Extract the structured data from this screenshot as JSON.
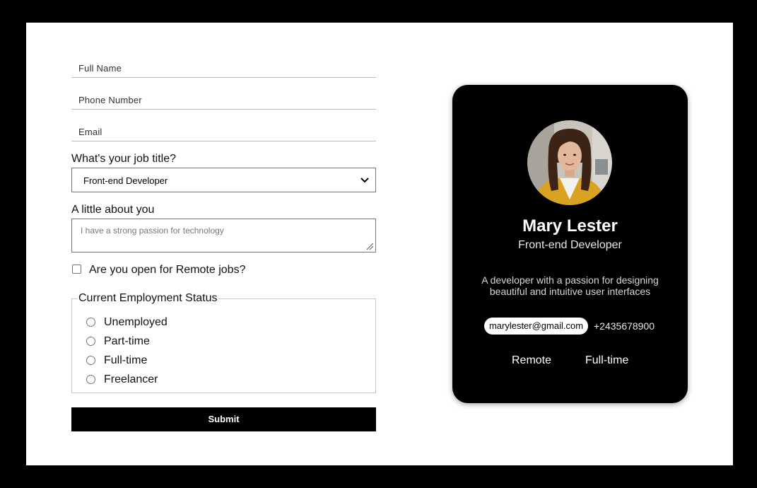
{
  "form": {
    "full_name_placeholder": "Full Name",
    "phone_placeholder": "Phone Number",
    "email_placeholder": "Email",
    "job_title_label": "What's your job title?",
    "job_title_value": "Front-end Developer",
    "about_label": "A little about you",
    "about_placeholder": "I have a strong passion for technology",
    "remote_label": "Are you open for Remote jobs?",
    "employment_legend": "Current Employment Status",
    "employment_options": [
      "Unemployed",
      "Part-time",
      "Full-time",
      "Freelancer"
    ],
    "submit_label": "Submit"
  },
  "card": {
    "name": "Mary Lester",
    "role": "Front-end Developer",
    "bio": "A developer with a passion for designing beautiful and intuitive user interfaces",
    "email": "marylester@gmail.com",
    "phone": "+2435678900",
    "tags": [
      "Remote",
      "Full-time"
    ]
  },
  "colors": {
    "background": "#000000",
    "page": "#ffffff",
    "card": "#000000",
    "submit": "#000000"
  },
  "icons": {
    "select_chevron": "chevron-down-icon",
    "textarea_grip": "resize-grip-icon"
  }
}
